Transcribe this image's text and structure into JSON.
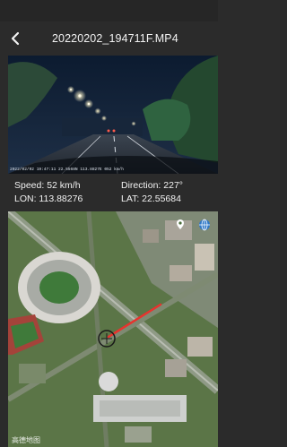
{
  "header": {
    "title": "20220202_194711F.MP4",
    "back_icon": "chevron-left-icon"
  },
  "video": {
    "overlay_text": "2022/02/02 19:47:11 22.5568N 113.8827E 052 km/h"
  },
  "info": {
    "speed": "Speed: 52 km/h",
    "direction": "Direction: 227°",
    "lon": "LON: 113.88276",
    "lat": "LAT: 22.55684"
  },
  "map": {
    "logo": "高德地图",
    "location_button_icon": "map-pin-icon",
    "layers_button_icon": "globe-icon",
    "route_color": "#e8332e"
  },
  "colors": {
    "background": "#2b2b2b",
    "text": "#f2f2f2"
  }
}
